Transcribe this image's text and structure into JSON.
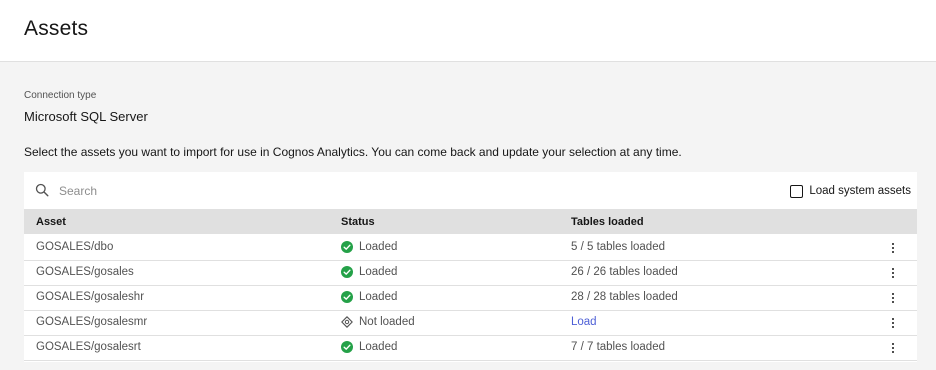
{
  "header": {
    "title": "Assets"
  },
  "connection": {
    "label": "Connection type",
    "value": "Microsoft SQL Server"
  },
  "instructions": "Select the assets you want to import for use in Cognos Analytics. You can come back and update your selection at any time.",
  "search": {
    "placeholder": "Search",
    "value": ""
  },
  "system_assets": {
    "label": "Load system assets",
    "checked": false
  },
  "table": {
    "columns": [
      "Asset",
      "Status",
      "Tables loaded"
    ],
    "rows": [
      {
        "asset": "GOSALES/dbo",
        "status": "Loaded",
        "status_icon": "check-circle-icon",
        "tables": "5 / 5 tables loaded"
      },
      {
        "asset": "GOSALES/gosales",
        "status": "Loaded",
        "status_icon": "check-circle-icon",
        "tables": "26 / 26 tables loaded"
      },
      {
        "asset": "GOSALES/gosaleshr",
        "status": "Loaded",
        "status_icon": "check-circle-icon",
        "tables": "28 / 28 tables loaded"
      },
      {
        "asset": "GOSALES/gosalesmr",
        "status": "Not loaded",
        "status_icon": "not-loaded-icon",
        "tables": "Load"
      },
      {
        "asset": "GOSALES/gosalesrt",
        "status": "Loaded",
        "status_icon": "check-circle-icon",
        "tables": "7 / 7 tables loaded"
      }
    ]
  },
  "colors": {
    "success": "#24a148",
    "link": "#4d5fd6",
    "header_bg": "#e0e0e0",
    "page_bg": "#f4f4f4"
  }
}
